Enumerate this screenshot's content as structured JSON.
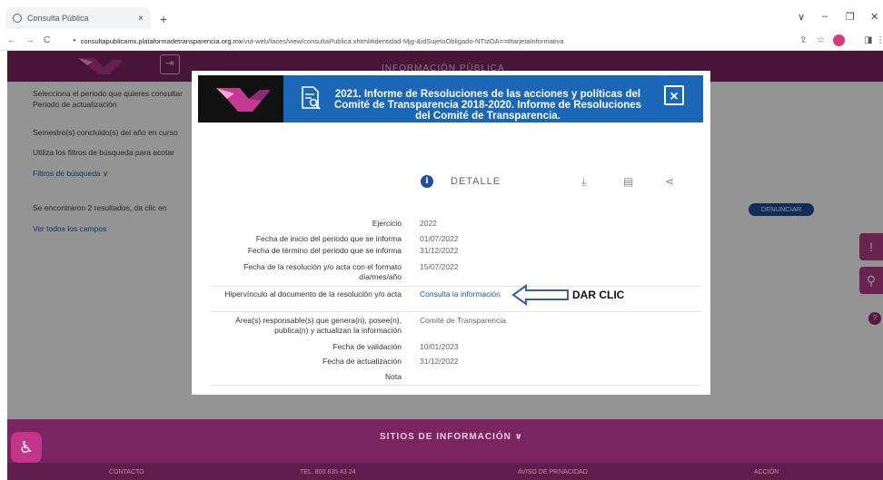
{
  "browser": {
    "tab_title": "Consulta Pública",
    "tab_close": "×",
    "new_tab": "+",
    "url_domain": "consultapublicamx.plataformadetransparencia.org.mx",
    "url_path": "/vut-web/faces/view/consultaPublica.xhtml#identidad-Mjg-&idSujetoObligado-NTIzOA==#tarjetaInformativa",
    "nav_back": "←",
    "nav_forward": "→",
    "nav_reload": "C",
    "lock": "●",
    "win_min": "–",
    "win_max": "❐",
    "win_close": "✕",
    "chevron": "∨",
    "ext_star": "☆",
    "ext_share": "⇪",
    "ext_sidebar": "◨",
    "ext_menu": "⋮"
  },
  "header": {
    "title": "INFORMACIÓN PÚBLICA",
    "icon": "⇥"
  },
  "background": {
    "period_prompt": "Selecciona el periodo que quieres consultar",
    "period_label": "Periodo de actualización",
    "semesters_text": "Semestre(s) concluido(s) del año en curso",
    "filters_hint": "Utiliza los filtros de búsqueda para acotar",
    "filters_link": "Filtros de búsqueda ∨",
    "results_text": "Se encontraron 2 resultados, da clic en",
    "all_fields_link": "Ver todos los campos",
    "denunciar_button": "DENUNCIAR"
  },
  "modal": {
    "title": "2021. Informe de Resoluciones de las acciones y políticas del Comité de Transparencia 2018-2020. Informe de Resoluciones del Comité de Transparencia.",
    "close_label": "×",
    "detail_label": "DETALLE",
    "info_glyph": "i",
    "download_glyph": "⤓",
    "print_glyph": "▤",
    "share_glyph": "⋖",
    "rows": [
      {
        "label": "Ejercicio",
        "value": "2022"
      },
      {
        "label": "Fecha de inicio del periodo que se informa",
        "value": "01/07/2022"
      },
      {
        "label": "Fecha de término del periodo que se informa",
        "value": "31/12/2022"
      },
      {
        "label": "Fecha de la resolución y/o acta con el formato día/mes/año",
        "value": "15/07/2022"
      },
      {
        "label": "Hipervínculo al documento de la resolución y/o acta",
        "value": "Consulta la información"
      },
      {
        "label": "Área(s) responsable(s) que genera(n), posee(n), publica(n) y actualizan la información",
        "value": "Comité de Transparencia"
      },
      {
        "label": "Fecha de validación",
        "value": "10/01/2023"
      },
      {
        "label": "Fecha de actualización",
        "value": "31/12/2022"
      },
      {
        "label": "Nota",
        "value": ""
      }
    ]
  },
  "annotation": {
    "text": "DAR CLIC"
  },
  "footer": {
    "title": "SITIOS DE INFORMACIÓN ∨",
    "items": [
      "CONTACTO",
      "TEL. 800 835 43 24",
      "AVISO DE PRIVACIDAD",
      "ACCIÓN"
    ]
  },
  "side": {
    "alert_glyph": "!",
    "search_glyph": "⚲",
    "help_glyph": "?",
    "access_glyph": "♿"
  },
  "colors": {
    "brand": "#7a2561",
    "modal_header": "#1b67b6",
    "link": "#1a5fb4"
  }
}
